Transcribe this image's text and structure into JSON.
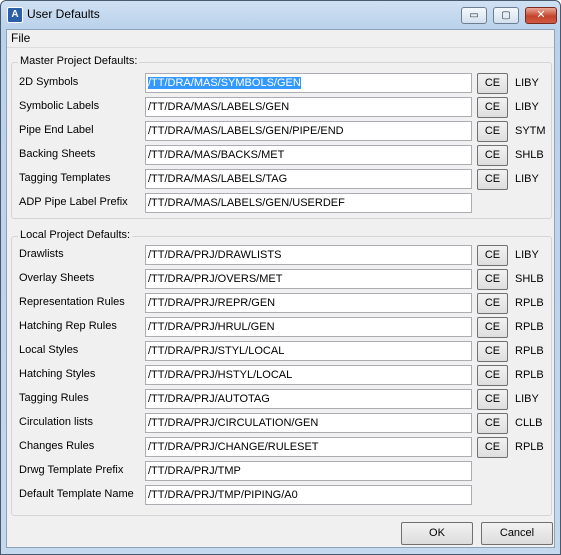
{
  "window": {
    "title": "User Defaults",
    "minimize_label": "▭",
    "maximize_label": "▢",
    "close_label": "✕"
  },
  "menu": {
    "file": "File"
  },
  "master": {
    "title": "Master Project Defaults:",
    "rows": [
      {
        "label": "2D Symbols",
        "value": "/TT/DRA/MAS/SYMBOLS/GEN",
        "ce": "CE",
        "code": "LIBY",
        "selected": true
      },
      {
        "label": "Symbolic Labels",
        "value": "/TT/DRA/MAS/LABELS/GEN",
        "ce": "CE",
        "code": "LIBY"
      },
      {
        "label": "Pipe End Label",
        "value": "/TT/DRA/MAS/LABELS/GEN/PIPE/END",
        "ce": "CE",
        "code": "SYTM"
      },
      {
        "label": "Backing Sheets",
        "value": "/TT/DRA/MAS/BACKS/MET",
        "ce": "CE",
        "code": "SHLB"
      },
      {
        "label": "Tagging Templates",
        "value": "/TT/DRA/MAS/LABELS/TAG",
        "ce": "CE",
        "code": "LIBY"
      },
      {
        "label": "ADP Pipe Label Prefix",
        "value": "/TT/DRA/MAS/LABELS/GEN/USERDEF"
      }
    ]
  },
  "local": {
    "title": "Local Project Defaults:",
    "rows": [
      {
        "label": "Drawlists",
        "value": "/TT/DRA/PRJ/DRAWLISTS",
        "ce": "CE",
        "code": "LIBY"
      },
      {
        "label": "Overlay Sheets",
        "value": "/TT/DRA/PRJ/OVERS/MET",
        "ce": "CE",
        "code": "SHLB"
      },
      {
        "label": "Representation Rules",
        "value": "/TT/DRA/PRJ/REPR/GEN",
        "ce": "CE",
        "code": "RPLB"
      },
      {
        "label": "Hatching Rep Rules",
        "value": "/TT/DRA/PRJ/HRUL/GEN",
        "ce": "CE",
        "code": "RPLB"
      },
      {
        "label": "Local Styles",
        "value": "/TT/DRA/PRJ/STYL/LOCAL",
        "ce": "CE",
        "code": "RPLB"
      },
      {
        "label": "Hatching Styles",
        "value": "/TT/DRA/PRJ/HSTYL/LOCAL",
        "ce": "CE",
        "code": "RPLB"
      },
      {
        "label": "Tagging Rules",
        "value": "/TT/DRA/PRJ/AUTOTAG",
        "ce": "CE",
        "code": "LIBY"
      },
      {
        "label": "Circulation lists",
        "value": "/TT/DRA/PRJ/CIRCULATION/GEN",
        "ce": "CE",
        "code": "CLLB"
      },
      {
        "label": "Changes Rules",
        "value": "/TT/DRA/PRJ/CHANGE/RULESET",
        "ce": "CE",
        "code": "RPLB"
      },
      {
        "label": "Drwg Template Prefix",
        "value": "/TT/DRA/PRJ/TMP"
      },
      {
        "label": "Default Template Name",
        "value": "/TT/DRA/PRJ/TMP/PIPING/A0"
      }
    ]
  },
  "buttons": {
    "ok": "OK",
    "cancel": "Cancel"
  }
}
